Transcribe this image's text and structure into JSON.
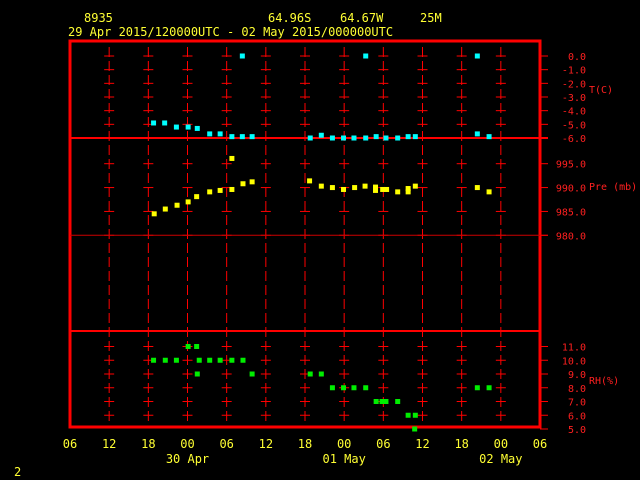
{
  "header": {
    "station": "8935",
    "latitude": "64.96S",
    "longitude": "64.67W",
    "elevation": "25M",
    "period": "29 Apr 2015/120000UTC - 02 May 2015/000000UTC"
  },
  "page_number": "2",
  "colors": {
    "frame": "#ff0000",
    "text": "#ffff33",
    "temperature": "#00ffff",
    "pressure": "#ffff00",
    "rh": "#00ee00"
  },
  "chart_data": {
    "type": "scatter",
    "x_range": [
      "2015-04-29T06:00",
      "2015-05-02T06:00"
    ],
    "x_tick_labels": [
      "06",
      "12",
      "18",
      "00",
      "06",
      "12",
      "18",
      "00",
      "06",
      "12",
      "18",
      "00",
      "06"
    ],
    "x_date_labels": [
      {
        "label": "30 Apr",
        "at": "2015-04-30T00:00"
      },
      {
        "label": "01 May",
        "at": "2015-05-01T00:00"
      },
      {
        "label": "02 May",
        "at": "2015-05-02T00:00"
      }
    ],
    "panels": [
      {
        "ylabel": "T(C)",
        "yticks": [
          "0.0",
          "-1.0",
          "-2.0",
          "-3.0",
          "-4.0",
          "-5.0",
          "-6.0"
        ],
        "ylim": [
          -6,
          0
        ],
        "points": [
          [
            "2015-04-29T18:48",
            -4.9
          ],
          [
            "2015-04-29T20:30",
            -4.9
          ],
          [
            "2015-04-29T22:18",
            -5.2
          ],
          [
            "2015-04-30T00:06",
            -5.2
          ],
          [
            "2015-04-30T01:30",
            -5.3
          ],
          [
            "2015-04-30T03:24",
            -5.7
          ],
          [
            "2015-04-30T05:00",
            -5.7
          ],
          [
            "2015-04-30T06:48",
            -5.9
          ],
          [
            "2015-04-30T08:24",
            -5.9
          ],
          [
            "2015-04-30T08:24",
            0.0
          ],
          [
            "2015-04-30T09:54",
            -5.9
          ],
          [
            "2015-04-30T18:48",
            -6.0
          ],
          [
            "2015-04-30T20:30",
            -5.8
          ],
          [
            "2015-04-30T22:12",
            -6.0
          ],
          [
            "2015-04-30T23:54",
            -6.0
          ],
          [
            "2015-05-01T01:30",
            -6.0
          ],
          [
            "2015-05-01T03:18",
            -6.0
          ],
          [
            "2015-05-01T03:18",
            0.0
          ],
          [
            "2015-05-01T04:54",
            -5.9
          ],
          [
            "2015-05-01T06:24",
            -6.0
          ],
          [
            "2015-05-01T08:12",
            -6.0
          ],
          [
            "2015-05-01T09:48",
            -5.9
          ],
          [
            "2015-05-01T10:54",
            -5.9
          ],
          [
            "2015-05-01T20:24",
            -5.7
          ],
          [
            "2015-05-01T20:24",
            0.0
          ],
          [
            "2015-05-01T22:12",
            -5.9
          ]
        ]
      },
      {
        "ylabel": "Pre (mb)",
        "yticks": [
          "995.0",
          "990.0",
          "985.0",
          "980.0"
        ],
        "ylim": [
          980,
          995
        ],
        "points": [
          [
            "2015-04-29T18:54",
            984.5
          ],
          [
            "2015-04-29T20:36",
            985.5
          ],
          [
            "2015-04-29T22:24",
            986.3
          ],
          [
            "2015-04-30T00:06",
            987.0
          ],
          [
            "2015-04-30T01:24",
            988.1
          ],
          [
            "2015-04-30T03:24",
            989.1
          ],
          [
            "2015-04-30T05:00",
            989.4
          ],
          [
            "2015-04-30T06:48",
            996.1
          ],
          [
            "2015-04-30T06:48",
            989.6
          ],
          [
            "2015-04-30T08:30",
            990.8
          ],
          [
            "2015-04-30T09:54",
            991.2
          ],
          [
            "2015-04-30T18:42",
            991.4
          ],
          [
            "2015-04-30T20:30",
            990.3
          ],
          [
            "2015-04-30T22:12",
            990.0
          ],
          [
            "2015-04-30T23:54",
            989.6
          ],
          [
            "2015-05-01T01:36",
            990.0
          ],
          [
            "2015-05-01T03:12",
            990.3
          ],
          [
            "2015-05-01T04:48",
            990.1
          ],
          [
            "2015-05-01T04:48",
            989.4
          ],
          [
            "2015-05-01T05:54",
            989.6
          ],
          [
            "2015-05-01T06:30",
            989.6
          ],
          [
            "2015-05-01T08:12",
            989.1
          ],
          [
            "2015-05-01T09:48",
            989.1
          ],
          [
            "2015-05-01T09:48",
            989.8
          ],
          [
            "2015-05-01T10:54",
            990.3
          ],
          [
            "2015-05-01T20:24",
            990.0
          ],
          [
            "2015-05-01T22:12",
            989.1
          ]
        ]
      },
      {
        "ylabel": "RH(%)",
        "yticks": [
          "11.0",
          "10.0",
          "9.0",
          "8.0",
          "7.0",
          "6.0",
          "5.0"
        ],
        "ylim": [
          5,
          11
        ],
        "points": [
          [
            "2015-04-29T18:48",
            10
          ],
          [
            "2015-04-29T20:36",
            10
          ],
          [
            "2015-04-29T22:18",
            10
          ],
          [
            "2015-04-30T00:06",
            11
          ],
          [
            "2015-04-30T01:24",
            11
          ],
          [
            "2015-04-30T01:48",
            10
          ],
          [
            "2015-04-30T01:30",
            9
          ],
          [
            "2015-04-30T03:24",
            10
          ],
          [
            "2015-04-30T05:00",
            10
          ],
          [
            "2015-04-30T06:48",
            10
          ],
          [
            "2015-04-30T08:30",
            10
          ],
          [
            "2015-04-30T09:54",
            9
          ],
          [
            "2015-04-30T18:48",
            9
          ],
          [
            "2015-04-30T20:30",
            9
          ],
          [
            "2015-04-30T22:12",
            8
          ],
          [
            "2015-04-30T23:54",
            8
          ],
          [
            "2015-05-01T01:30",
            8
          ],
          [
            "2015-05-01T03:18",
            8
          ],
          [
            "2015-05-01T04:54",
            7
          ],
          [
            "2015-05-01T05:48",
            7
          ],
          [
            "2015-05-01T06:24",
            7
          ],
          [
            "2015-05-01T08:12",
            7
          ],
          [
            "2015-05-01T09:48",
            6
          ],
          [
            "2015-05-01T10:54",
            6
          ],
          [
            "2015-05-01T10:48",
            5
          ],
          [
            "2015-05-01T20:24",
            8
          ],
          [
            "2015-05-01T22:12",
            8
          ]
        ]
      }
    ]
  }
}
